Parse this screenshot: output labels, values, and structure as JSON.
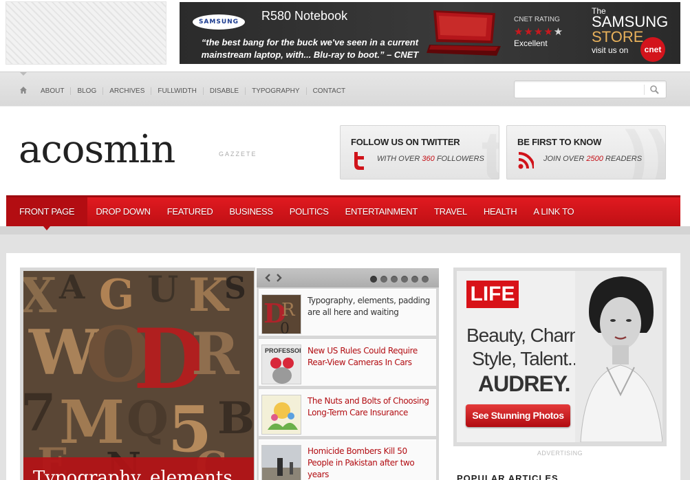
{
  "banner_ad": {
    "brand": "SAMSUNG",
    "product": "R580 Notebook",
    "quote": "“the best bang for the buck we've seen in a current mainstream laptop, with...  Blu-ray to boot.” – CNET",
    "rating_title": "CNET RATING",
    "rating_value": "4 of 5",
    "rating_text": "Excellent",
    "store_the": "The",
    "store_brand": "SAMSUNG",
    "store_store": "STORE",
    "store_visit": "visit us on",
    "cnet": "cnet"
  },
  "top_menu": [
    "ABOUT",
    "BLOG",
    "ARCHIVES",
    "FULLWIDTH",
    "DISABLE",
    "TYPOGRAPHY",
    "CONTACT"
  ],
  "search": {
    "placeholder": "",
    "value": ""
  },
  "logo": {
    "name": "acosmin",
    "tagline": "GAZZETE"
  },
  "twitter_box": {
    "title": "FOLLOW US ON TWITTER",
    "sub_prefix": "WITH OVER",
    "count": "360",
    "sub_suffix": "FOLLOWERS"
  },
  "rss_box": {
    "title": "BE FIRST TO KNOW",
    "sub_prefix": "JOIN OVER",
    "count": "2500",
    "sub_suffix": "READERS"
  },
  "main_nav": [
    "FRONT PAGE",
    "DROP DOWN",
    "FEATURED",
    "BUSINESS",
    "POLITICS",
    "ENTERTAINMENT",
    "TRAVEL",
    "HEALTH",
    "A LINK TO"
  ],
  "feature": {
    "caption": "Typography, elements"
  },
  "slider": {
    "dots": 6,
    "articles": [
      {
        "title": "Typography, elements, padding are all here and waiting"
      },
      {
        "title": "New US Rules Could Require Rear-View Cameras In Cars"
      },
      {
        "title": "The Nuts and Bolts of Choosing Long-Term Care Insurance"
      },
      {
        "title": "Homicide Bombers Kill 50 People in Pakistan after two years"
      }
    ]
  },
  "side_ad": {
    "brand": "LIFE",
    "line1": "Beauty, Charm,",
    "line2": "Style, Talent...",
    "line3": "AUDREY.",
    "cta": "See Stunning Photos",
    "label": "ADVERTISING"
  },
  "popular": {
    "title": "POPULAR ARTICLES"
  },
  "colors": {
    "accent": "#c40d14",
    "nav_red": "#d4161b",
    "topbar_grey": "#dedede"
  }
}
